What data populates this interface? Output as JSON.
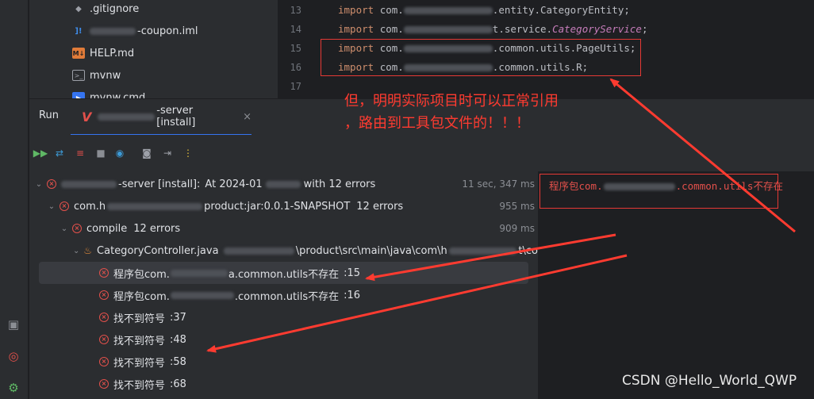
{
  "project_tree": {
    "files": [
      {
        "name": ".gitignore",
        "icon": "gitignore-icon"
      },
      {
        "name": "-coupon.iml",
        "icon": "iml-file-icon"
      },
      {
        "name": "HELP.md",
        "icon": "markdown-icon"
      },
      {
        "name": "mvnw",
        "icon": "terminal-icon"
      },
      {
        "name": "mvnw.cmd",
        "icon": "cmd-icon"
      }
    ]
  },
  "editor": {
    "lines": [
      {
        "num": "13",
        "kw": "import",
        "pre": "com.",
        "post": ".entity.CategoryEntity;"
      },
      {
        "num": "14",
        "kw": "import",
        "pre": "com.",
        "post_plain": "t.service.",
        "post_italic": "CategoryService",
        "post_end": ";"
      },
      {
        "num": "15",
        "kw": "import",
        "pre": "com.",
        "post": ".common.utils.PageUtils;"
      },
      {
        "num": "16",
        "kw": "import",
        "pre": "com.",
        "post": ".common.utils.R;"
      },
      {
        "num": "17"
      }
    ]
  },
  "run_panel": {
    "title": "Run",
    "tab_label": "-server [install]",
    "tab_close": "×"
  },
  "build_tree": {
    "root": {
      "label": "-server [install]:",
      "detail": "At 2024-01",
      "suffix": "with 12 errors",
      "duration": "11 sec, 347 ms"
    },
    "module": {
      "label": "com.h",
      "mid": "product:jar:0.0.1-SNAPSHOT",
      "errors": "12 errors",
      "duration": "955 ms"
    },
    "compile": {
      "label": "compile",
      "errors": "12 errors",
      "duration": "909 ms"
    },
    "file": {
      "label": "CategoryController.java",
      "path": "\\product\\src\\main\\java\\com\\h",
      "path_end": "t\\co"
    },
    "errors": [
      {
        "text_a": "程序包com.",
        "text_b": "a.common.utils不存在",
        "line": ":15",
        "selected": true
      },
      {
        "text_a": "程序包com.",
        "text_b": ".common.utils不存在",
        "line": ":16",
        "selected": false
      },
      {
        "text": "找不到符号",
        "line": ":37"
      },
      {
        "text": "找不到符号",
        "line": ":48"
      },
      {
        "text": "找不到符号",
        "line": ":58"
      },
      {
        "text": "找不到符号",
        "line": ":68"
      }
    ]
  },
  "console": {
    "line_a": "程序包com.",
    "line_b": ".common.utils不存在"
  },
  "annotation": {
    "line1": "但，明明实际项目时可以正常引用",
    "line2": "，路由到工具包文件的！！！",
    "color": "#ff3b30"
  },
  "watermark": "CSDN @Hello_World_QWP",
  "colors": {
    "error": "#e3504b",
    "accent": "#3574f0",
    "annotation_red": "#e53935"
  }
}
